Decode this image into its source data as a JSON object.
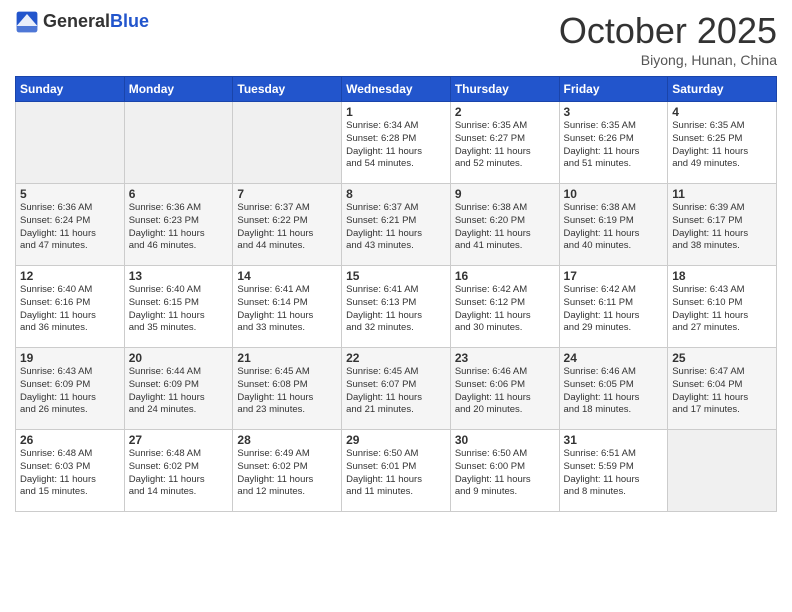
{
  "header": {
    "logo_general": "General",
    "logo_blue": "Blue",
    "month_title": "October 2025",
    "location": "Biyong, Hunan, China"
  },
  "days_of_week": [
    "Sunday",
    "Monday",
    "Tuesday",
    "Wednesday",
    "Thursday",
    "Friday",
    "Saturday"
  ],
  "weeks": [
    [
      {
        "day": "",
        "info": ""
      },
      {
        "day": "",
        "info": ""
      },
      {
        "day": "",
        "info": ""
      },
      {
        "day": "1",
        "info": "Sunrise: 6:34 AM\nSunset: 6:28 PM\nDaylight: 11 hours\nand 54 minutes."
      },
      {
        "day": "2",
        "info": "Sunrise: 6:35 AM\nSunset: 6:27 PM\nDaylight: 11 hours\nand 52 minutes."
      },
      {
        "day": "3",
        "info": "Sunrise: 6:35 AM\nSunset: 6:26 PM\nDaylight: 11 hours\nand 51 minutes."
      },
      {
        "day": "4",
        "info": "Sunrise: 6:35 AM\nSunset: 6:25 PM\nDaylight: 11 hours\nand 49 minutes."
      }
    ],
    [
      {
        "day": "5",
        "info": "Sunrise: 6:36 AM\nSunset: 6:24 PM\nDaylight: 11 hours\nand 47 minutes."
      },
      {
        "day": "6",
        "info": "Sunrise: 6:36 AM\nSunset: 6:23 PM\nDaylight: 11 hours\nand 46 minutes."
      },
      {
        "day": "7",
        "info": "Sunrise: 6:37 AM\nSunset: 6:22 PM\nDaylight: 11 hours\nand 44 minutes."
      },
      {
        "day": "8",
        "info": "Sunrise: 6:37 AM\nSunset: 6:21 PM\nDaylight: 11 hours\nand 43 minutes."
      },
      {
        "day": "9",
        "info": "Sunrise: 6:38 AM\nSunset: 6:20 PM\nDaylight: 11 hours\nand 41 minutes."
      },
      {
        "day": "10",
        "info": "Sunrise: 6:38 AM\nSunset: 6:19 PM\nDaylight: 11 hours\nand 40 minutes."
      },
      {
        "day": "11",
        "info": "Sunrise: 6:39 AM\nSunset: 6:17 PM\nDaylight: 11 hours\nand 38 minutes."
      }
    ],
    [
      {
        "day": "12",
        "info": "Sunrise: 6:40 AM\nSunset: 6:16 PM\nDaylight: 11 hours\nand 36 minutes."
      },
      {
        "day": "13",
        "info": "Sunrise: 6:40 AM\nSunset: 6:15 PM\nDaylight: 11 hours\nand 35 minutes."
      },
      {
        "day": "14",
        "info": "Sunrise: 6:41 AM\nSunset: 6:14 PM\nDaylight: 11 hours\nand 33 minutes."
      },
      {
        "day": "15",
        "info": "Sunrise: 6:41 AM\nSunset: 6:13 PM\nDaylight: 11 hours\nand 32 minutes."
      },
      {
        "day": "16",
        "info": "Sunrise: 6:42 AM\nSunset: 6:12 PM\nDaylight: 11 hours\nand 30 minutes."
      },
      {
        "day": "17",
        "info": "Sunrise: 6:42 AM\nSunset: 6:11 PM\nDaylight: 11 hours\nand 29 minutes."
      },
      {
        "day": "18",
        "info": "Sunrise: 6:43 AM\nSunset: 6:10 PM\nDaylight: 11 hours\nand 27 minutes."
      }
    ],
    [
      {
        "day": "19",
        "info": "Sunrise: 6:43 AM\nSunset: 6:09 PM\nDaylight: 11 hours\nand 26 minutes."
      },
      {
        "day": "20",
        "info": "Sunrise: 6:44 AM\nSunset: 6:09 PM\nDaylight: 11 hours\nand 24 minutes."
      },
      {
        "day": "21",
        "info": "Sunrise: 6:45 AM\nSunset: 6:08 PM\nDaylight: 11 hours\nand 23 minutes."
      },
      {
        "day": "22",
        "info": "Sunrise: 6:45 AM\nSunset: 6:07 PM\nDaylight: 11 hours\nand 21 minutes."
      },
      {
        "day": "23",
        "info": "Sunrise: 6:46 AM\nSunset: 6:06 PM\nDaylight: 11 hours\nand 20 minutes."
      },
      {
        "day": "24",
        "info": "Sunrise: 6:46 AM\nSunset: 6:05 PM\nDaylight: 11 hours\nand 18 minutes."
      },
      {
        "day": "25",
        "info": "Sunrise: 6:47 AM\nSunset: 6:04 PM\nDaylight: 11 hours\nand 17 minutes."
      }
    ],
    [
      {
        "day": "26",
        "info": "Sunrise: 6:48 AM\nSunset: 6:03 PM\nDaylight: 11 hours\nand 15 minutes."
      },
      {
        "day": "27",
        "info": "Sunrise: 6:48 AM\nSunset: 6:02 PM\nDaylight: 11 hours\nand 14 minutes."
      },
      {
        "day": "28",
        "info": "Sunrise: 6:49 AM\nSunset: 6:02 PM\nDaylight: 11 hours\nand 12 minutes."
      },
      {
        "day": "29",
        "info": "Sunrise: 6:50 AM\nSunset: 6:01 PM\nDaylight: 11 hours\nand 11 minutes."
      },
      {
        "day": "30",
        "info": "Sunrise: 6:50 AM\nSunset: 6:00 PM\nDaylight: 11 hours\nand 9 minutes."
      },
      {
        "day": "31",
        "info": "Sunrise: 6:51 AM\nSunset: 5:59 PM\nDaylight: 11 hours\nand 8 minutes."
      },
      {
        "day": "",
        "info": ""
      }
    ]
  ]
}
